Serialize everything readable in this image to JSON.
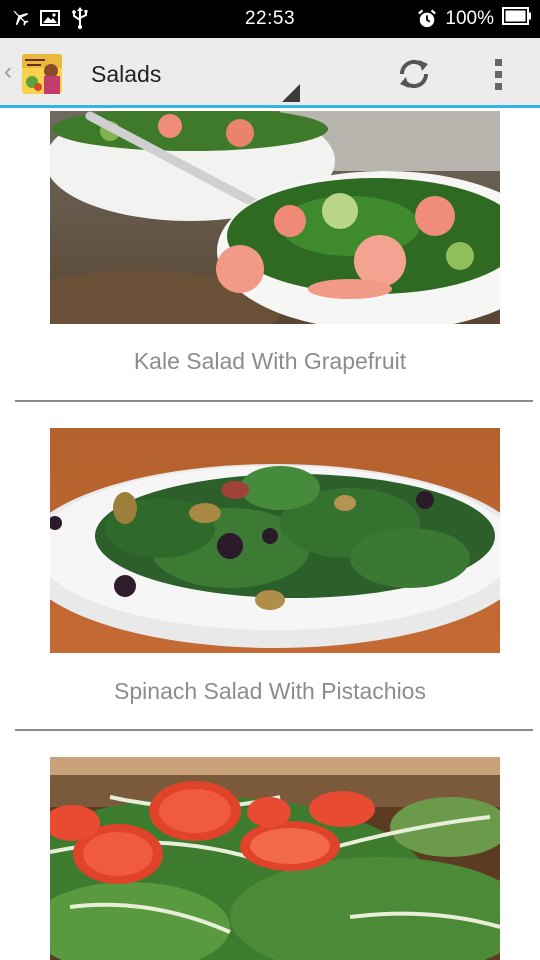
{
  "status_bar": {
    "time": "22:53",
    "battery": "100%",
    "icons_left": [
      "airplane-icon",
      "image-icon",
      "usb-icon"
    ],
    "icons_right": [
      "alarm-icon",
      "battery-icon"
    ]
  },
  "action_bar": {
    "title": "Salads",
    "icons": [
      "app-logo",
      "refresh-icon",
      "overflow-menu-icon"
    ],
    "accent_color": "#33b5e5"
  },
  "recipes": [
    {
      "title": "Kale Salad With Grapefruit",
      "image": "kale-grapefruit-salad-photo"
    },
    {
      "title": "Spinach Salad With Pistachios",
      "image": "spinach-pistachio-salad-photo"
    },
    {
      "title": "",
      "image": "tomato-greens-salad-photo"
    }
  ]
}
